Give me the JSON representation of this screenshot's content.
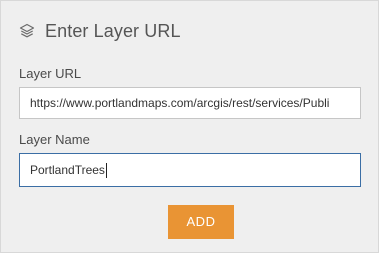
{
  "header": {
    "title": "Enter Layer URL",
    "icon": "layers-icon"
  },
  "url_field": {
    "label": "Layer URL",
    "value": "https://www.portlandmaps.com/arcgis/rest/services/Publi"
  },
  "name_field": {
    "label": "Layer Name",
    "value": "PortlandTrees"
  },
  "actions": {
    "add_label": "ADD",
    "add_color": "#e99434"
  },
  "colors": {
    "panel_bg": "#efefef",
    "focus_border": "#3b6ea5"
  }
}
